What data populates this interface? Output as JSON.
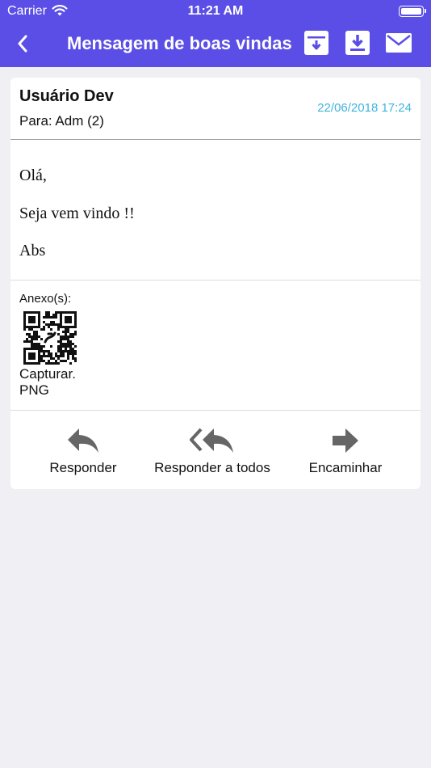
{
  "status_bar": {
    "carrier": "Carrier",
    "time": "11:21 AM"
  },
  "nav": {
    "back_icon": "chevron-left-icon",
    "title": "Mensagem de boas vindas",
    "actions": [
      "archive-icon",
      "download-icon",
      "mail-icon"
    ]
  },
  "message": {
    "sender": "Usuário Dev",
    "date": "22/06/2018 17:24",
    "recipient": "Para: Adm (2)",
    "body": [
      "Olá,",
      "Seja vem vindo !!",
      "Abs"
    ]
  },
  "attachments": {
    "label": "Anexo(s):",
    "items": [
      {
        "name_line1": "Capturar.",
        "name_line2": "PNG",
        "thumbnail_icon": "qr-code-icon"
      }
    ]
  },
  "actions": {
    "reply": "Responder",
    "reply_all": "Responder a todos",
    "forward": "Encaminhar"
  },
  "colors": {
    "header": "#5b4ee6",
    "date_text": "#3fb4de",
    "background": "#efeff4",
    "action_icon": "#666666"
  }
}
